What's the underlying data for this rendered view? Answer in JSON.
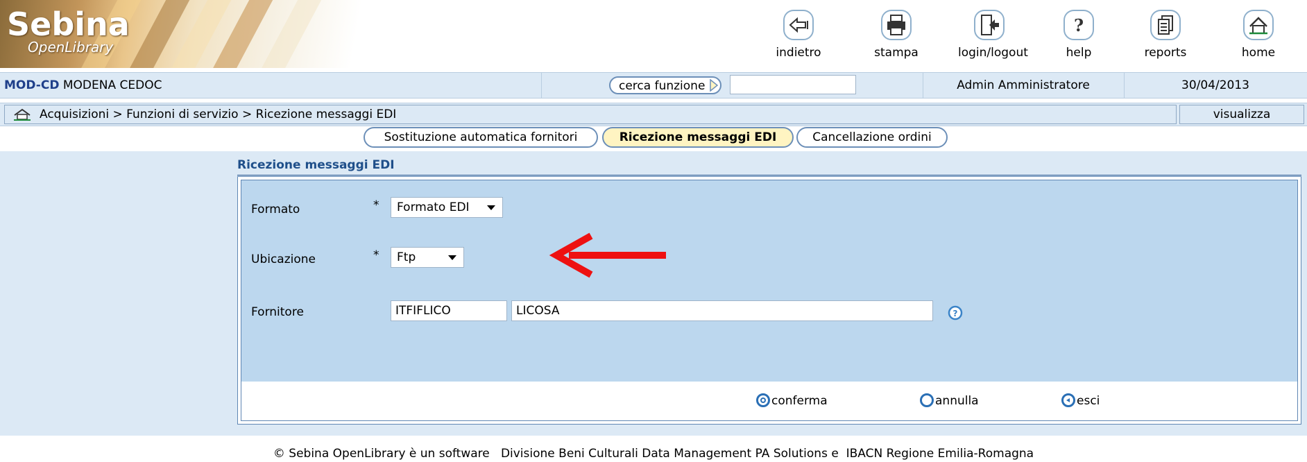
{
  "logo": {
    "title": "Sebina",
    "subtitle": "OpenLibrary"
  },
  "toolbar": [
    {
      "label": "indietro",
      "icon": "back-icon"
    },
    {
      "label": "stampa",
      "icon": "print-icon"
    },
    {
      "label": "login/logout",
      "icon": "logout-icon"
    },
    {
      "label": "help",
      "icon": "help-icon"
    },
    {
      "label": "reports",
      "icon": "reports-icon"
    },
    {
      "label": "home",
      "icon": "home-icon"
    }
  ],
  "session": {
    "library_code": "MOD-CD",
    "library_name": "MODENA CEDOC",
    "search_button": "cerca funzione",
    "search_value": "",
    "user": "Admin Amministratore",
    "date": "30/04/2013"
  },
  "breadcrumb": {
    "text": "Acquisizioni > Funzioni di servizio > Ricezione messaggi EDI",
    "view_button": "visualizza"
  },
  "tabs": [
    {
      "label": "Sostituzione automatica fornitori",
      "active": false
    },
    {
      "label": "Ricezione messaggi EDI",
      "active": true
    },
    {
      "label": "Cancellazione ordini",
      "active": false
    }
  ],
  "form": {
    "title": "Ricezione messaggi EDI",
    "formato": {
      "label": "Formato",
      "required": "*",
      "value": "Formato EDI"
    },
    "ubicazione": {
      "label": "Ubicazione",
      "required": "*",
      "value": "Ftp"
    },
    "fornitore": {
      "label": "Fornitore",
      "code": "ITFIFLICO",
      "name": "LICOSA"
    }
  },
  "actions": {
    "confirm": "conferma",
    "cancel": "annulla",
    "exit": "esci"
  },
  "footer": "© Sebina OpenLibrary è un software   Divisione Beni Culturali Data Management PA Solutions e  IBACN Regione Emilia-Romagna",
  "colors": {
    "accent": "#2a6fb5",
    "bar": "#dce9f5",
    "panel": "#bcd7ee",
    "arrow": "#ee1111",
    "active_tab": "#fff4c2"
  }
}
